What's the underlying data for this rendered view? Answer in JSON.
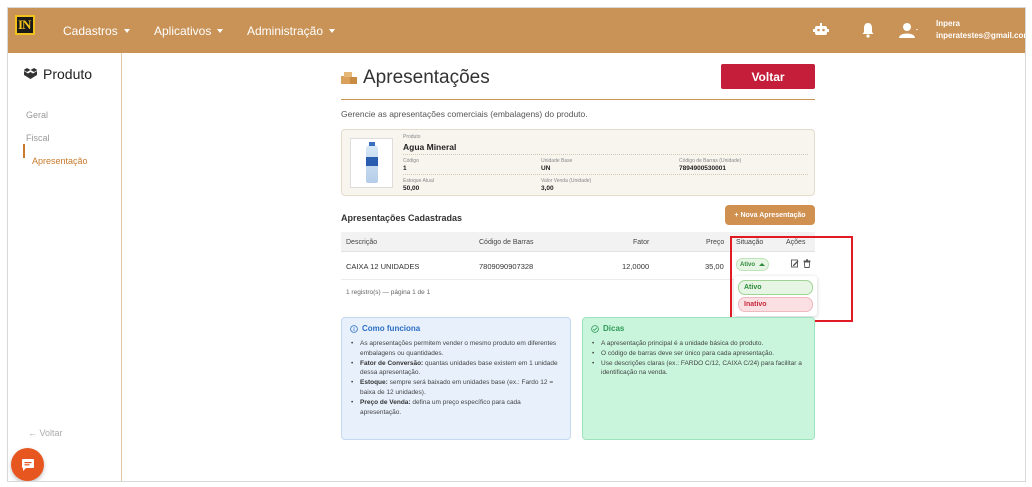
{
  "navbar": {
    "logo_text": "IN",
    "menu": [
      {
        "label": "Cadastros"
      },
      {
        "label": "Aplicativos"
      },
      {
        "label": "Administração"
      }
    ],
    "user": {
      "name": "Inpera",
      "email": "inperatestes@gmail.com"
    },
    "colors": {
      "bar": "#c99256",
      "logo_border": "#f2c21b"
    }
  },
  "sidebar": {
    "title": "Produto",
    "items": [
      {
        "label": "Geral",
        "active": false
      },
      {
        "label": "Fiscal",
        "active": false
      },
      {
        "label": "Apresentação",
        "active": true
      }
    ],
    "back_label": "← Voltar"
  },
  "page": {
    "title": "Apresentações",
    "back_button": "Voltar",
    "subtitle": "Gerencie as apresentações comerciais (embalagens) do produto."
  },
  "product": {
    "produto_label": "Produto",
    "produto_value": "Agua Mineral",
    "codigo_label": "Código",
    "codigo_value": "1",
    "unidade_label": "Unidade Base",
    "unidade_value": "UN",
    "barras_label": "Código de Barras (Unidade)",
    "barras_value": "7894900530001",
    "estoque_label": "Estoque Atual",
    "estoque_value": "50,00",
    "valor_label": "Valor Venda (Unidade)",
    "valor_value": "3,00"
  },
  "presentations": {
    "title": "Apresentações Cadastradas",
    "new_button": "+ Nova Apresentação",
    "columns": [
      "Descrição",
      "Código de Barras",
      "Fator",
      "Preço",
      "Situação",
      "Ações"
    ],
    "rows": [
      {
        "descricao": "CAIXA 12 UNIDADES",
        "codigo": "7809090907328",
        "fator": "12,0000",
        "preco": "35,00",
        "situacao": "Ativo"
      }
    ],
    "pager": "1 registro(s) — página 1 de 1",
    "status_options": [
      "Ativo",
      "Inativo"
    ]
  },
  "info": {
    "how_title": "Como funciona",
    "how_items": [
      {
        "strong": "",
        "text": "As apresentações permitem vender o mesmo produto em diferentes embalagens ou quantidades."
      },
      {
        "strong": "Fator de Conversão:",
        "text": " quantas unidades base existem em 1 unidade dessa apresentação."
      },
      {
        "strong": "Estoque:",
        "text": " sempre será baixado em unidades base (ex.: Fardo 12 = baixa de 12 unidades)."
      },
      {
        "strong": "Preço de Venda:",
        "text": " defina um preço específico para cada apresentação."
      }
    ],
    "tips_title": "Dicas",
    "tips_items": [
      "A apresentação principal é a unidade básica do produto.",
      "O código de barras deve ser único para cada apresentação.",
      "Use descrições claras (ex.: FARDO C/12, CAIXA C/24) para facilitar a identificação na venda."
    ]
  }
}
